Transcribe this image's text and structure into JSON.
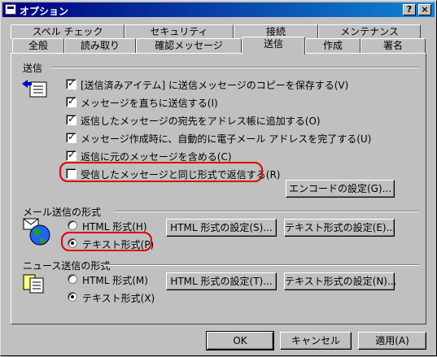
{
  "window": {
    "title": "オプション",
    "help_button": "?",
    "close_button": "×"
  },
  "tabs_row_back": [
    "スペル チェック",
    "セキュリティ",
    "接続",
    "メンテナンス"
  ],
  "tabs_row_front": [
    "全般",
    "読み取り",
    "確認メッセージ",
    "送信",
    "作成",
    "署名"
  ],
  "send": {
    "group_label": "送信",
    "options": [
      {
        "label": "[送信済みアイテム] に送信メッセージのコピーを保存する(V)",
        "checked": true
      },
      {
        "label": "メッセージを直ちに送信する(I)",
        "checked": true
      },
      {
        "label": "返信したメッセージの宛先をアドレス帳に追加する(O)",
        "checked": true
      },
      {
        "label": "メッセージ作成時に、自動的に電子メール アドレスを完了する(U)",
        "checked": true
      },
      {
        "label": "返信に元のメッセージを含める(C)",
        "checked": true
      },
      {
        "label": "受信したメッセージと同じ形式で返信する(R)",
        "checked": false
      }
    ],
    "encode_button": "エンコードの設定(G)..."
  },
  "mail_format": {
    "group_label": "メール送信の形式",
    "html_option": "HTML 形式(H)",
    "text_option": "テキスト形式(P)",
    "selected": "text",
    "html_settings_button": "HTML 形式の設定(S)...",
    "text_settings_button": "テキスト形式の設定(E)..."
  },
  "news_format": {
    "group_label": "ニュース送信の形式",
    "html_option": "HTML 形式(M)",
    "text_option": "テキスト形式(X)",
    "selected": "text",
    "html_settings_button": "HTML 形式の設定(T)...",
    "text_settings_button": "テキスト形式の設定(N)..."
  },
  "footer": {
    "ok": "OK",
    "cancel": "キャンセル",
    "apply": "適用(A)"
  },
  "colors": {
    "titlebar": "#000080",
    "highlight_ring": "#e00000",
    "face": "#c0c0c0"
  }
}
